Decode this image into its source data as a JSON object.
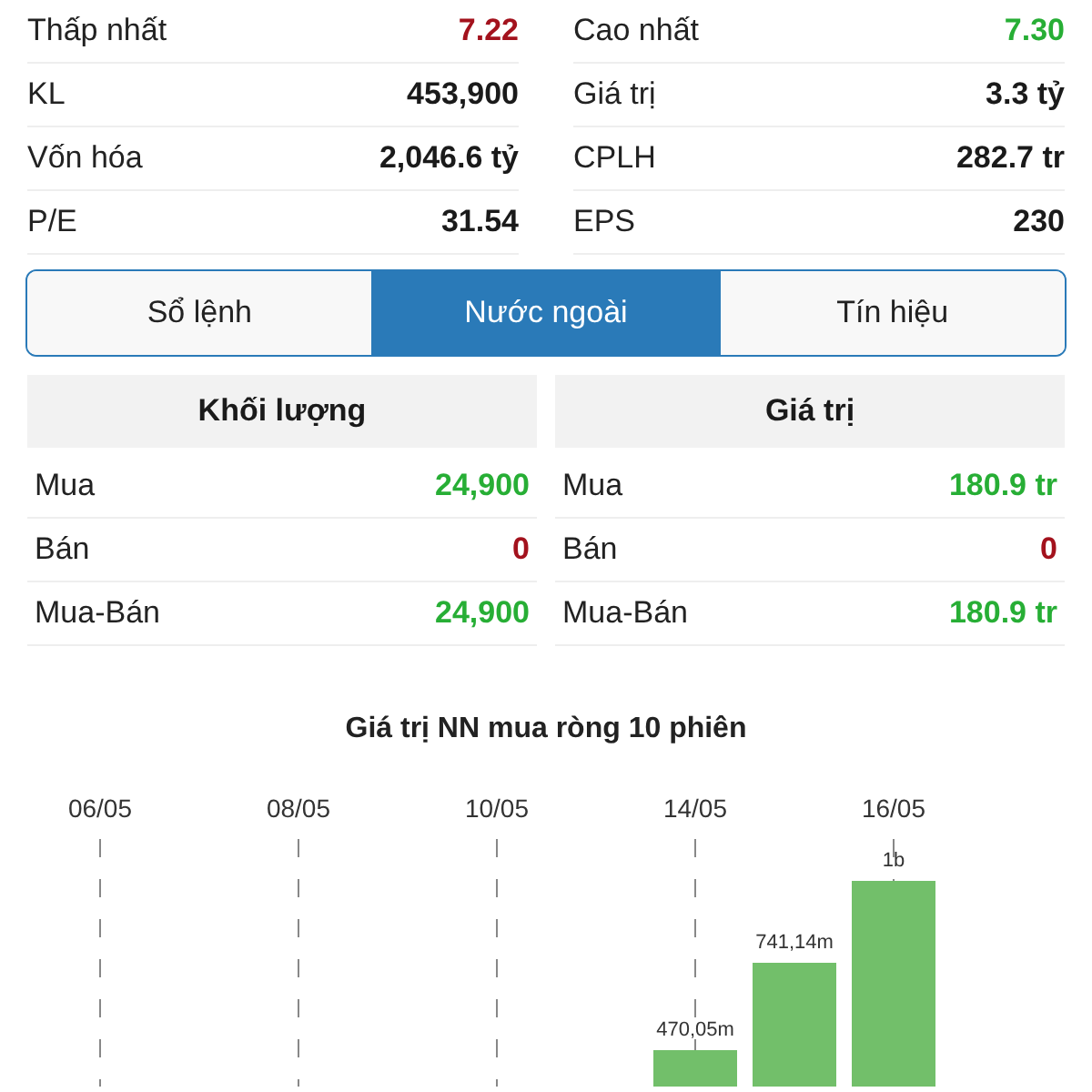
{
  "stats": [
    {
      "left": {
        "label": "Thấp nhất",
        "value": "7.22",
        "color": "#a3121d"
      },
      "right": {
        "label": "Cao nhất",
        "value": "7.30",
        "color": "#27ae35"
      }
    },
    {
      "left": {
        "label": "KL",
        "value": "453,900"
      },
      "right": {
        "label": "Giá trị",
        "value": "3.3 tỷ"
      }
    },
    {
      "left": {
        "label": "Vốn hóa",
        "value": "2,046.6 tỷ"
      },
      "right": {
        "label": "CPLH",
        "value": "282.7 tr"
      }
    },
    {
      "left": {
        "label": "P/E",
        "value": "31.54"
      },
      "right": {
        "label": "EPS",
        "value": "230"
      }
    }
  ],
  "tabs": [
    {
      "label": "Sổ lệnh",
      "selected": false
    },
    {
      "label": "Nước ngoài",
      "selected": true
    },
    {
      "label": "Tín hiệu",
      "selected": false
    }
  ],
  "foreign_tables": [
    {
      "header": "Khối lượng",
      "rows": [
        {
          "label": "Mua",
          "value": "24,900",
          "color": "#27ae35"
        },
        {
          "label": "Bán",
          "value": "0",
          "color": "#a3121d"
        },
        {
          "label": "Mua-Bán",
          "value": "24,900",
          "color": "#27ae35"
        }
      ]
    },
    {
      "header": "Giá trị",
      "rows": [
        {
          "label": "Mua",
          "value": "180.9 tr",
          "color": "#27ae35"
        },
        {
          "label": "Bán",
          "value": "0",
          "color": "#a3121d"
        },
        {
          "label": "Mua-Bán",
          "value": "180.9 tr",
          "color": "#27ae35"
        }
      ]
    }
  ],
  "chart": {
    "title": "Giá trị NN mua ròng 10 phiên",
    "axis_labels": [
      "06/05",
      "08/05",
      "10/05",
      "14/05",
      "16/05"
    ],
    "bar_labels": [
      "470,05m",
      "741,14m",
      "1b"
    ]
  }
}
